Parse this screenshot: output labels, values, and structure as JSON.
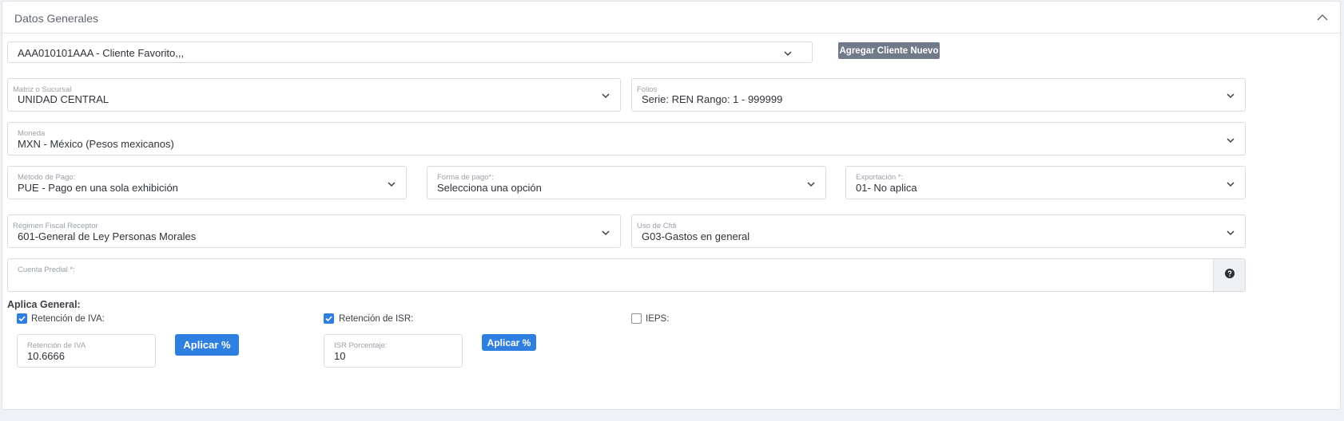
{
  "card": {
    "title": "Datos Generales"
  },
  "client": {
    "value": "AAA010101AAA - Cliente Favorito,,,",
    "add_button": "Agregar Cliente Nuevo"
  },
  "fields": {
    "matriz": {
      "label": "Matriz o Sucursal",
      "value": "UNIDAD CENTRAL"
    },
    "folios": {
      "label": "Folios",
      "value": "Serie: REN Rango: 1 - 999999"
    },
    "moneda": {
      "label": "Moneda",
      "value": "MXN - México (Pesos mexicanos)"
    },
    "metodo_pago": {
      "label": "Método de Pago:",
      "value": "PUE - Pago en una sola exhibición"
    },
    "forma_pago": {
      "label": "Forma de pago*:",
      "value": "Selecciona una opción"
    },
    "exportacion": {
      "label": "Exportación *:",
      "value": "01- No aplica"
    },
    "regimen": {
      "label": "Régimen Fiscal Receptor",
      "value": "601-General de Ley Personas Morales"
    },
    "uso_cfdi": {
      "label": "Uso de Cfdi",
      "value": "G03-Gastos en general"
    },
    "cuenta_predial": {
      "label": "Cuenta Predial *:",
      "value": ""
    }
  },
  "aplica": {
    "title": "Aplica General:",
    "ret_iva": {
      "label": "Retención de IVA:",
      "checked": true
    },
    "ret_isr": {
      "label": "Retención de ISR:",
      "checked": true
    },
    "ieps": {
      "label": "IEPS:",
      "checked": false
    },
    "iva_input": {
      "label": "Retención de IVA",
      "value": "10.6666"
    },
    "isr_input": {
      "label": "ISR Porcentaje:",
      "value": "10"
    },
    "apply_iva_button": "Aplicar %",
    "apply_isr_button": "Aplicar %"
  },
  "colors": {
    "accent": "#2f7fe0",
    "secondary_button": "#717a88",
    "border": "#d8dce1"
  },
  "icons": {
    "collapse": "chevron-up-icon",
    "dropdown": "chevron-down-icon",
    "help": "question-circle-icon",
    "check": "check-icon"
  }
}
